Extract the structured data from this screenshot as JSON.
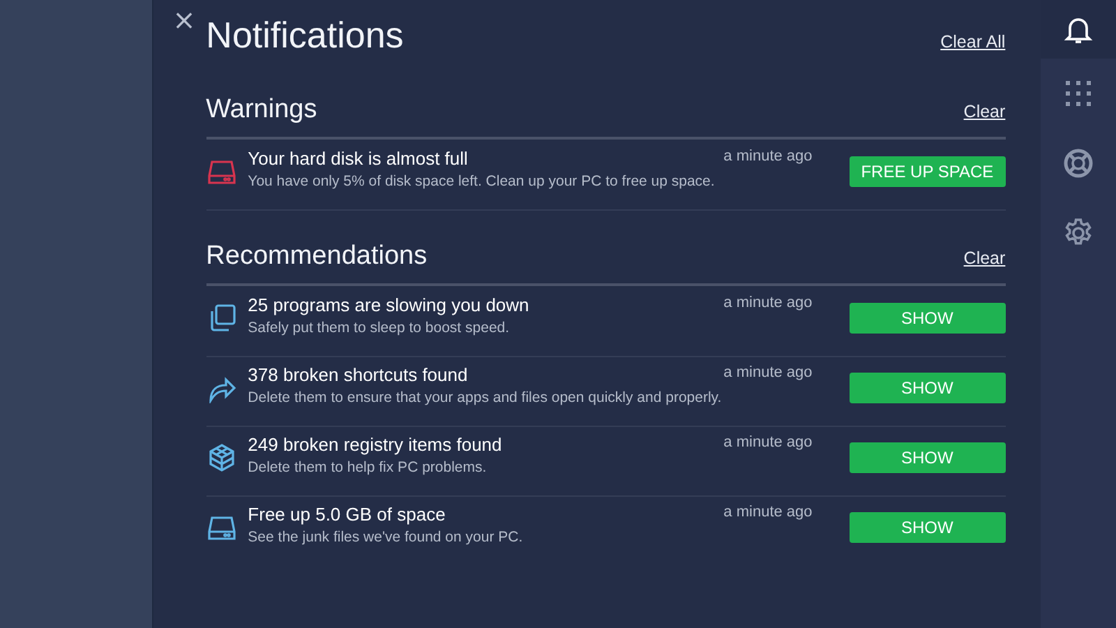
{
  "panel": {
    "close": "×",
    "title": "Notifications",
    "clear_all": "Clear All"
  },
  "sections": [
    {
      "title": "Warnings",
      "clear": "Clear",
      "items": [
        {
          "kind": "disk",
          "color": "#d8344f",
          "title": "Your hard disk is almost full",
          "description": "You have only 5% of disk space left. Clean up your PC to free up space.",
          "time": "a minute ago",
          "action": "FREE UP SPACE"
        }
      ]
    },
    {
      "title": "Recommendations",
      "clear": "Clear",
      "items": [
        {
          "kind": "windows",
          "color": "#5fb4e6",
          "title": "25 programs are slowing you down",
          "description": "Safely put them to sleep to boost speed.",
          "time": "a minute ago",
          "action": "SHOW"
        },
        {
          "kind": "arrow",
          "color": "#5fb4e6",
          "title": "378 broken shortcuts found",
          "description": "Delete them to ensure that your apps and files open quickly and properly.",
          "time": "a minute ago",
          "action": "SHOW"
        },
        {
          "kind": "cube",
          "color": "#5fb4e6",
          "title": "249 broken registry items found",
          "description": "Delete them to help fix PC problems.",
          "time": "a minute ago",
          "action": "SHOW"
        },
        {
          "kind": "disk",
          "color": "#5fb4e6",
          "title": "Free up 5.0 GB of space",
          "description": "See the junk files we've found on your PC.",
          "time": "a minute ago",
          "action": "SHOW"
        }
      ]
    }
  ],
  "sidebar": {
    "items": [
      {
        "kind": "bell",
        "selected": true
      },
      {
        "kind": "apps",
        "selected": false
      },
      {
        "kind": "help",
        "selected": false
      },
      {
        "kind": "settings",
        "selected": false
      }
    ]
  }
}
